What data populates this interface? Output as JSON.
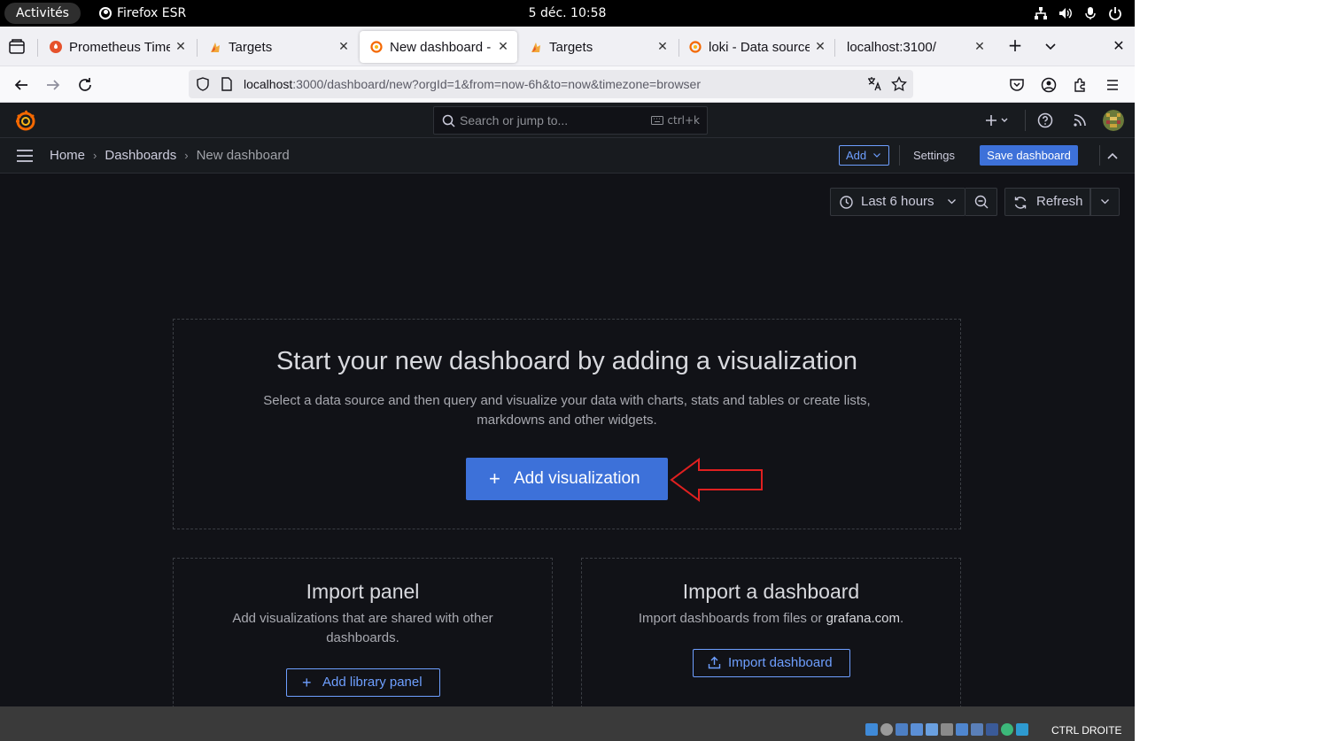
{
  "gnome": {
    "activities": "Activités",
    "app_name": "Firefox ESR",
    "clock": "5 déc.  10:58"
  },
  "tabs": [
    {
      "title": "Prometheus Time",
      "icon": "prometheus-icon",
      "active": false
    },
    {
      "title": "Targets",
      "icon": "prometheus-flame-icon",
      "active": false
    },
    {
      "title": "New dashboard - D",
      "icon": "grafana-icon",
      "active": true
    },
    {
      "title": "Targets",
      "icon": "prometheus-flame-icon",
      "active": false
    },
    {
      "title": "loki - Data sources",
      "icon": "grafana-icon",
      "active": false
    },
    {
      "title": "localhost:3100/",
      "icon": "",
      "active": false
    }
  ],
  "urlbar": {
    "host": "localhost",
    "rest": ":3000/dashboard/new?orgId=1&from=now-6h&to=now&timezone=browser"
  },
  "grafana": {
    "search_placeholder": "Search or jump to...",
    "search_shortcut": "ctrl+k",
    "breadcrumbs": [
      "Home",
      "Dashboards",
      "New dashboard"
    ],
    "add_label": "Add",
    "settings_label": "Settings",
    "save_label": "Save dashboard",
    "time_range": "Last 6 hours",
    "refresh_label": "Refresh",
    "accent_color": "#3d71d9",
    "link_color": "#6e9fff"
  },
  "empty_state": {
    "title": "Start your new dashboard by adding a visualization",
    "description": "Select a data source and then query and visualize your data with charts, stats and tables or create lists, markdowns and other widgets.",
    "add_viz_label": "Add visualization",
    "annotation_color": "#e02020"
  },
  "import_panel": {
    "title": "Import panel",
    "description": "Add visualizations that are shared with other dashboards.",
    "button_label": "Add library panel"
  },
  "import_dashboard": {
    "title": "Import a dashboard",
    "description_prefix": "Import dashboards from files or ",
    "description_link": "grafana.com",
    "description_suffix": ".",
    "button_label": "Import dashboard"
  },
  "vm_status": {
    "host_key": "CTRL DROITE"
  }
}
